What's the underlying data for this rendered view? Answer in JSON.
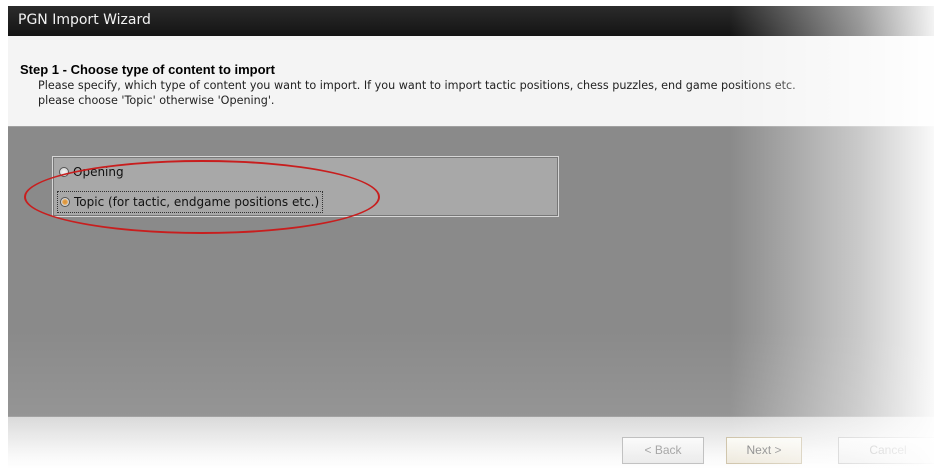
{
  "window": {
    "title": "PGN Import Wizard"
  },
  "header": {
    "step_title": "Step 1 - Choose type of content to import",
    "description": "Please specify, which type of content you want to import. If you want to import tactic positions, chess puzzles, end game positions etc. please choose 'Topic' otherwise 'Opening'."
  },
  "options": {
    "opening_label": "Opening",
    "topic_label": "Topic (for tactic, endgame positions etc.)",
    "selected": "Topic (for tactic, endgame positions etc.)"
  },
  "buttons": {
    "back": "< Back",
    "next": "Next >",
    "cancel": "Cancel"
  },
  "colors": {
    "highlight": "#c81e1e",
    "selected_radio": "#e9a349"
  }
}
